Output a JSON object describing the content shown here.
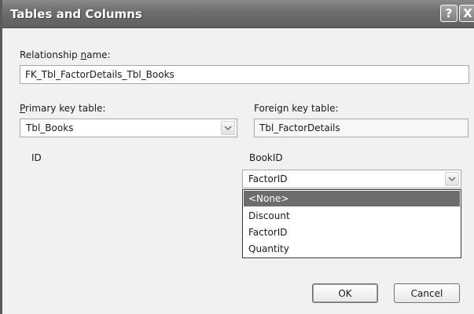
{
  "window": {
    "title": "Tables and Columns",
    "help_label": "?",
    "close_label": "X"
  },
  "relationship": {
    "label_prefix": "Relationship ",
    "label_accel": "n",
    "label_suffix": "ame:",
    "value": "FK_Tbl_FactorDetails_Tbl_Books"
  },
  "primary_key": {
    "label_accel": "P",
    "label_suffix": "rimary key table:",
    "selected": "Tbl_Books",
    "column": "ID"
  },
  "foreign_key": {
    "label": "Foreign key table:",
    "value": "Tbl_FactorDetails",
    "column": "BookID",
    "selected": "FactorID",
    "options": [
      "<None>",
      "Discount",
      "FactorID",
      "Quantity"
    ]
  },
  "buttons": {
    "ok": "OK",
    "cancel": "Cancel"
  },
  "icons": {
    "combo_arrow": "chevron-down-icon"
  }
}
